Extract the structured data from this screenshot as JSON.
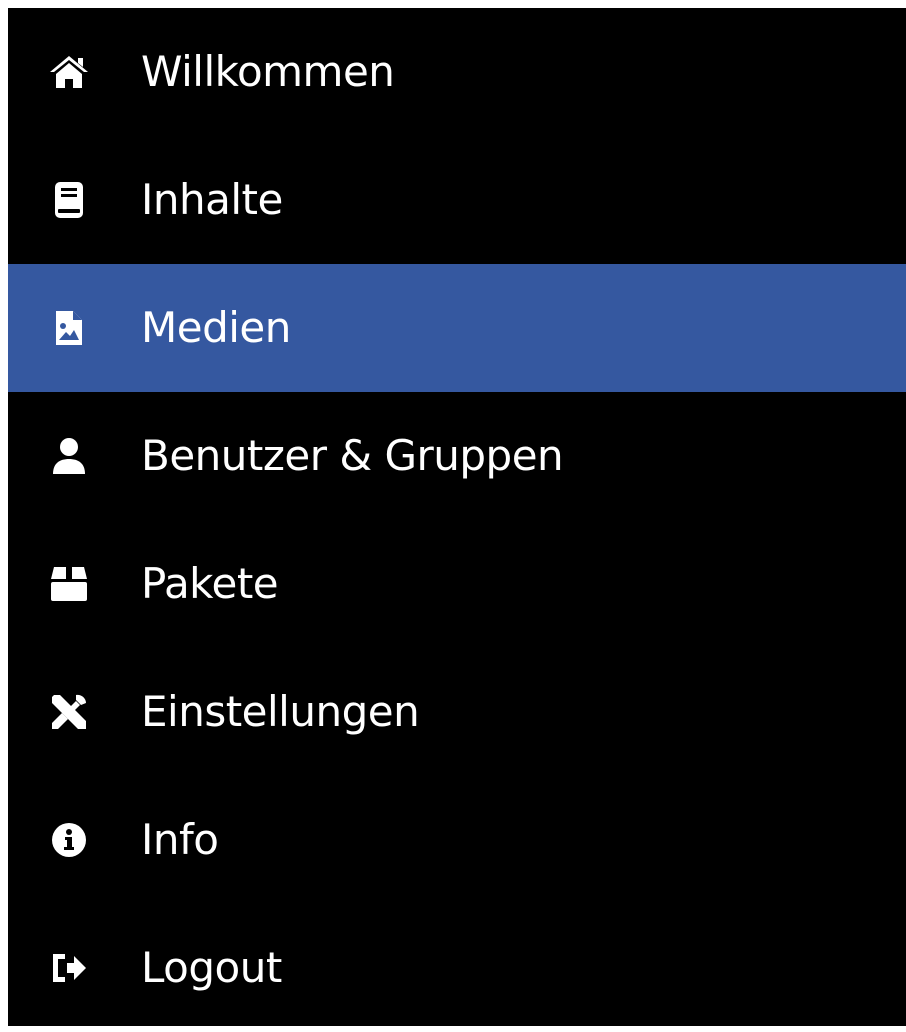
{
  "sidebar": {
    "active_color": "#3558a0",
    "background_color": "#000000",
    "items": [
      {
        "label": "Willkommen",
        "icon": "home-icon",
        "active": false
      },
      {
        "label": "Inhalte",
        "icon": "book-icon",
        "active": false
      },
      {
        "label": "Medien",
        "icon": "file-image-icon",
        "active": true
      },
      {
        "label": "Benutzer & Gruppen",
        "icon": "user-icon",
        "active": false
      },
      {
        "label": "Pakete",
        "icon": "package-icon",
        "active": false
      },
      {
        "label": "Einstellungen",
        "icon": "tools-icon",
        "active": false
      },
      {
        "label": "Info",
        "icon": "info-circle-icon",
        "active": false
      },
      {
        "label": "Logout",
        "icon": "logout-icon",
        "active": false
      }
    ]
  }
}
